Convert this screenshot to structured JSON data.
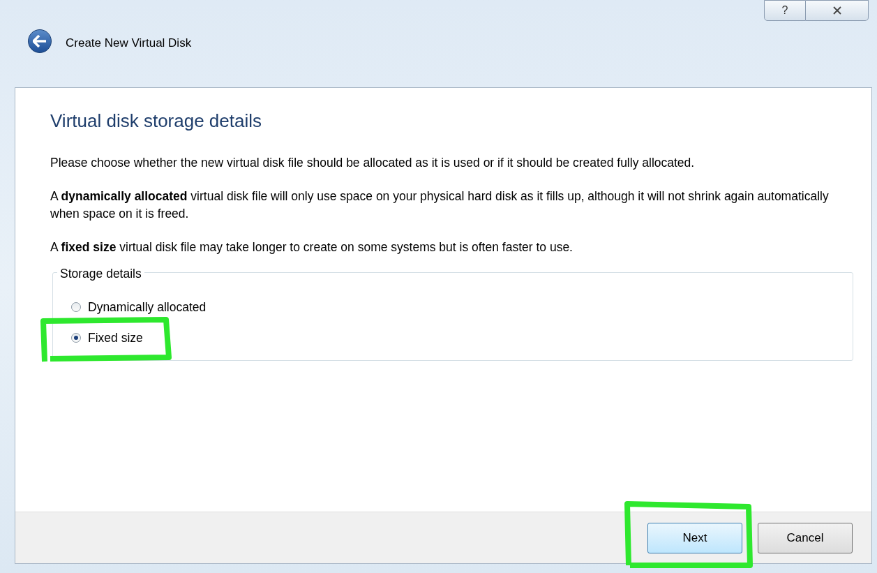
{
  "window": {
    "title": "Create New Virtual Disk",
    "help": "?"
  },
  "heading": "Virtual disk storage details",
  "paragraphs": [
    "Please choose whether the new virtual disk file should be allocated as it is used or if it should be created fully allocated.",
    "A **dynamically allocated** virtual disk file will only use space on your physical hard disk as it fills up, although it will not shrink again automatically when space on it is freed.",
    "A **fixed size** virtual disk file may take longer to create on some systems but is often faster to use."
  ],
  "storage": {
    "title": "Storage details",
    "options": [
      {
        "label": "Dynamically allocated",
        "selected": false
      },
      {
        "label": "Fixed size",
        "selected": true
      }
    ]
  },
  "buttons": [
    {
      "label": "Next",
      "default": true
    },
    {
      "label": "Cancel",
      "default": false
    }
  ]
}
